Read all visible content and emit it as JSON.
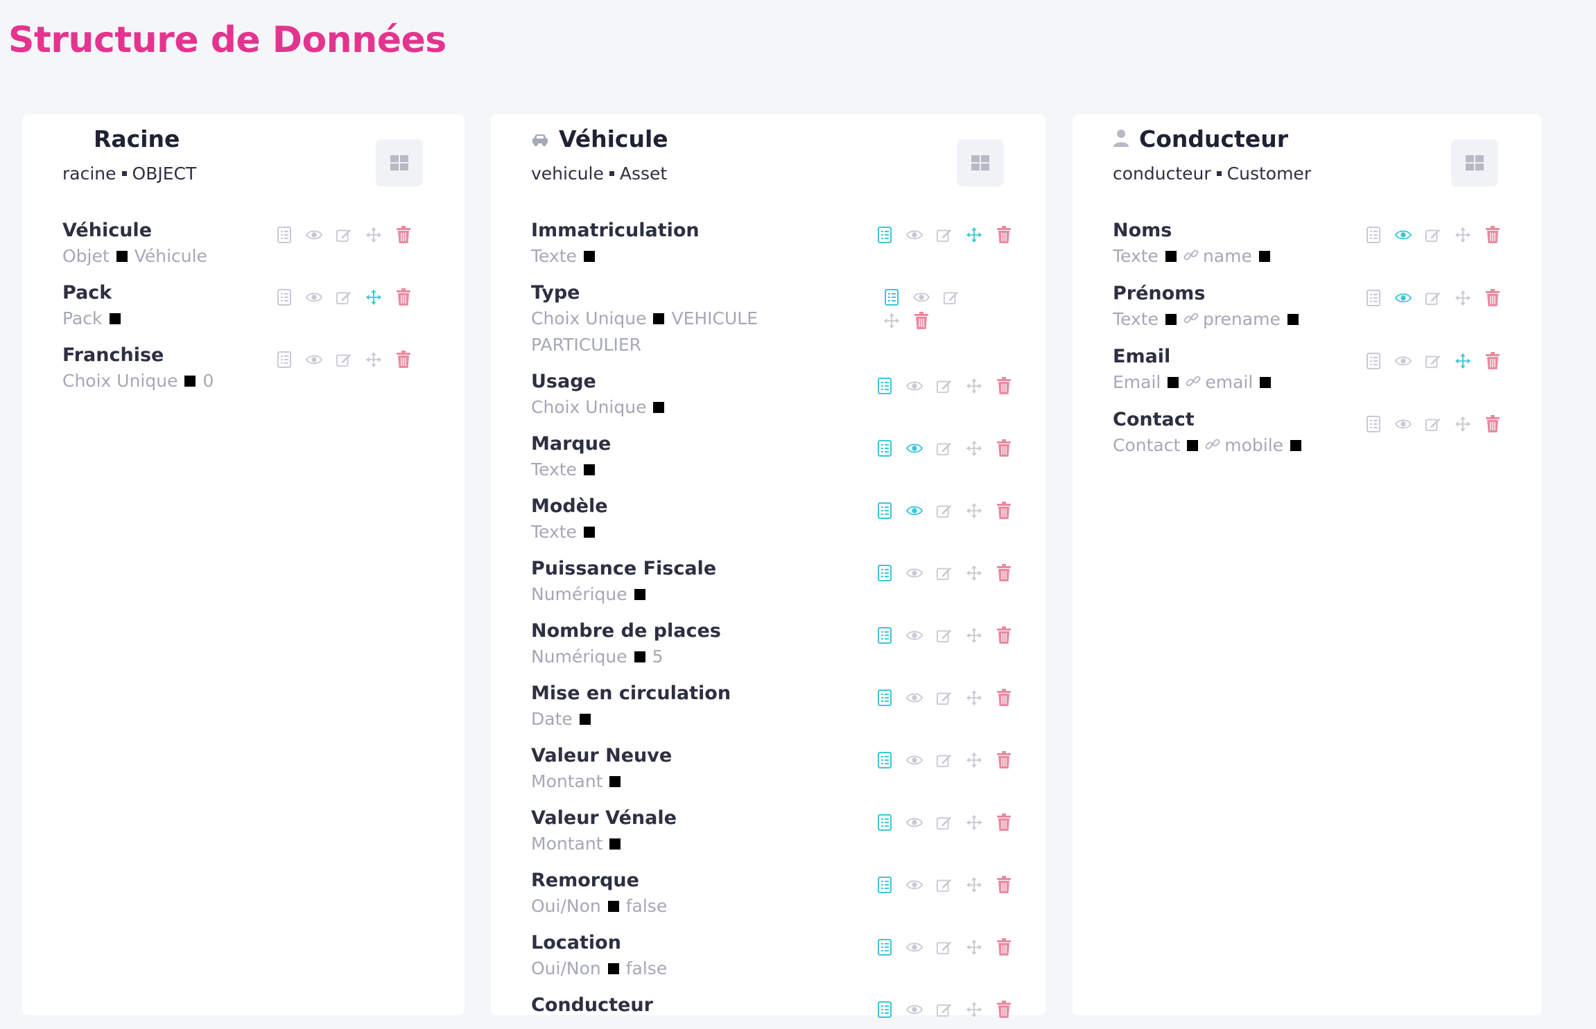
{
  "page": {
    "title": "Structure de Données"
  },
  "colors": {
    "accent": "#e3348f",
    "cyan": "#3cc6d6",
    "red": "#e98aa0",
    "gray": "#c8cad3"
  },
  "cards": [
    {
      "title": "Racine",
      "key": "racine",
      "kind": "OBJECT",
      "icon": "none",
      "fields": [
        {
          "name": "Véhicule",
          "type": "Objet",
          "extra": "Véhicule",
          "link": "",
          "active": "none"
        },
        {
          "name": "Pack",
          "type": "Pack",
          "extra": "",
          "link": "",
          "active": "move"
        },
        {
          "name": "Franchise",
          "type": "Choix Unique",
          "extra": "0",
          "link": "",
          "active": "none"
        }
      ]
    },
    {
      "title": "Véhicule",
      "key": "vehicule",
      "kind": "Asset",
      "icon": "car-icon",
      "fields": [
        {
          "name": "Immatriculation",
          "type": "Texte",
          "extra": "",
          "link": "",
          "active": "move"
        },
        {
          "name": "Type",
          "type": "Choix Unique",
          "extra": "VEHICULE PARTICULIER",
          "link": "",
          "active": "none"
        },
        {
          "name": "Usage",
          "type": "Choix Unique",
          "extra": "",
          "link": "",
          "active": "none"
        },
        {
          "name": "Marque",
          "type": "Texte",
          "extra": "",
          "link": "",
          "active": "eye"
        },
        {
          "name": "Modèle",
          "type": "Texte",
          "extra": "",
          "link": "",
          "active": "eye"
        },
        {
          "name": "Puissance Fiscale",
          "type": "Numérique",
          "extra": "",
          "link": "",
          "active": "none"
        },
        {
          "name": "Nombre de places",
          "type": "Numérique",
          "extra": "5",
          "link": "",
          "active": "none"
        },
        {
          "name": "Mise en circulation",
          "type": "Date",
          "extra": "",
          "link": "",
          "active": "none"
        },
        {
          "name": "Valeur Neuve",
          "type": "Montant",
          "extra": "",
          "link": "",
          "active": "none"
        },
        {
          "name": "Valeur Vénale",
          "type": "Montant",
          "extra": "",
          "link": "",
          "active": "none"
        },
        {
          "name": "Remorque",
          "type": "Oui/Non",
          "extra": "false",
          "link": "",
          "active": "none"
        },
        {
          "name": "Location",
          "type": "Oui/Non",
          "extra": "false",
          "link": "",
          "active": "none"
        },
        {
          "name": "Conducteur",
          "type": "",
          "extra": "",
          "link": "",
          "active": "none"
        }
      ]
    },
    {
      "title": "Conducteur",
      "key": "conducteur",
      "kind": "Customer",
      "icon": "person-icon",
      "fields": [
        {
          "name": "Noms",
          "type": "Texte",
          "extra": "",
          "link": "name",
          "active": "eye"
        },
        {
          "name": "Prénoms",
          "type": "Texte",
          "extra": "",
          "link": "prename",
          "active": "eye"
        },
        {
          "name": "Email",
          "type": "Email",
          "extra": "",
          "link": "email",
          "active": "move"
        },
        {
          "name": "Contact",
          "type": "Contact",
          "extra": "",
          "link": "mobile",
          "active": "none"
        }
      ]
    }
  ]
}
